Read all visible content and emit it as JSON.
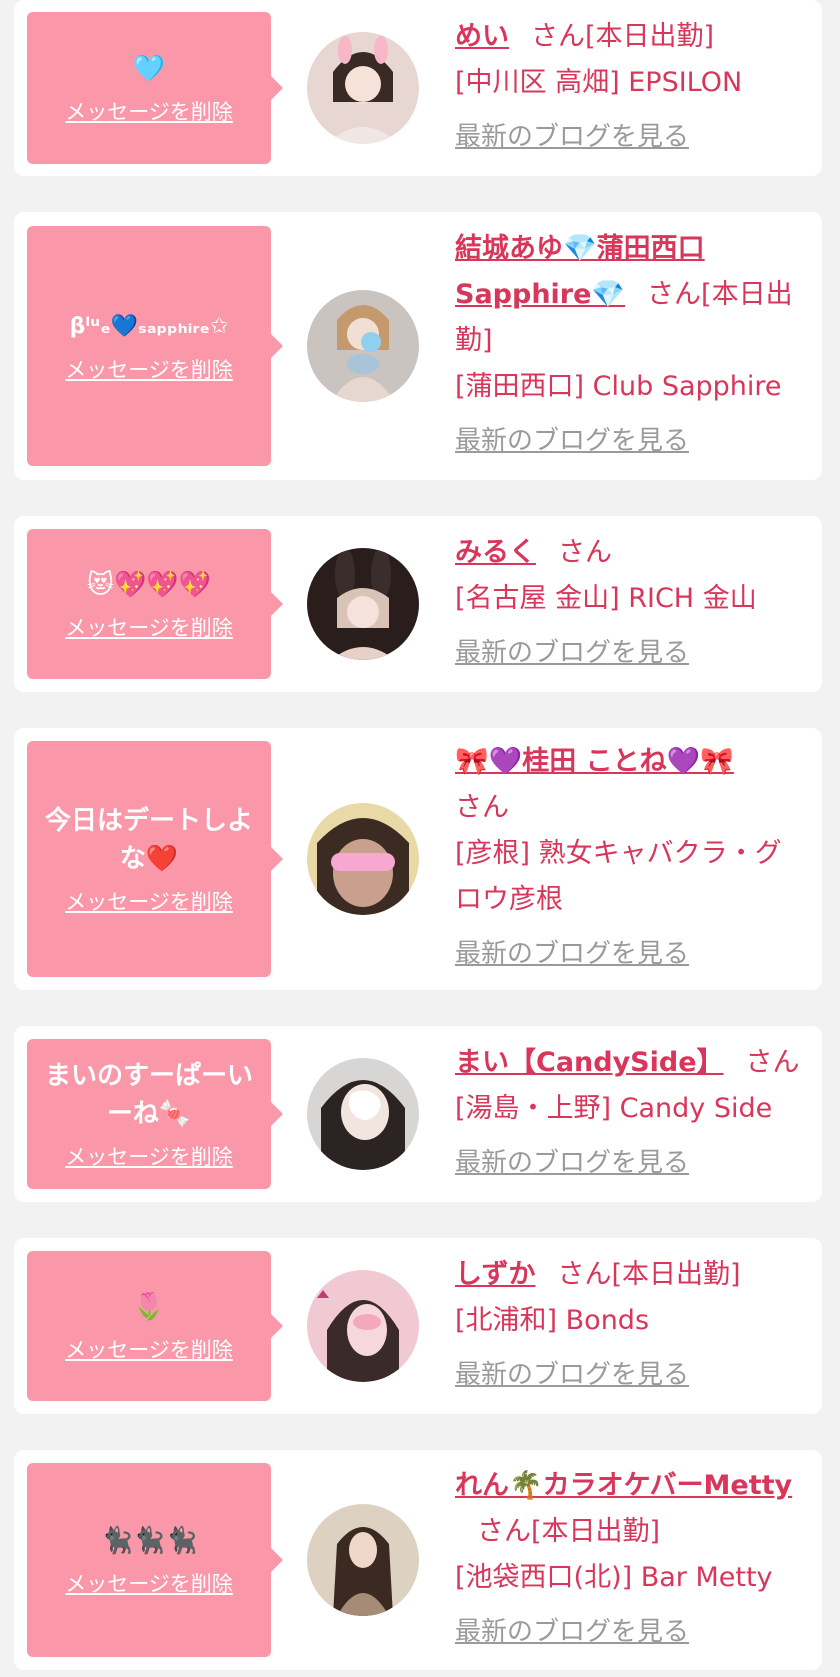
{
  "delete_label": "メッセージを削除",
  "blog_label": "最新のブログを見る",
  "san_label": "さん",
  "cards": [
    {
      "message": "🩵",
      "name": "めい",
      "status": "[本日出勤]",
      "shop": "[中川区 高畑] EPSILON"
    },
    {
      "message": "βˡᵘₑ💙ₛₐₚₚₕᵢᵣₑ✩",
      "name": "結城あゆ💎蒲田西口Sapphire💎",
      "status": "[本日出勤]",
      "shop": "[蒲田西口] Club Sapphire"
    },
    {
      "message": "😻💖💖💖",
      "name": "みるく",
      "status": "",
      "shop": "[名古屋 金山] RICH 金山"
    },
    {
      "message": "今日はデートしよな❤️",
      "name": "🎀💜桂田 ことね💜🎀",
      "status": "",
      "shop": "[彦根] 熟女キャバクラ・グロウ彦根"
    },
    {
      "message": "まいのすーぱーいーね🍬",
      "name": "まい【CandySide】",
      "status": "",
      "shop": "[湯島・上野] Candy Side"
    },
    {
      "message": "🌷",
      "name": "しずか",
      "status": "[本日出勤]",
      "shop": "[北浦和] Bonds"
    },
    {
      "message": "🐈‍⬛🐈‍⬛🐈‍⬛",
      "name": "れん🌴カラオケバーMetty",
      "status": "[本日出勤]",
      "shop": "[池袋西口(北)] Bar Metty"
    }
  ],
  "colors": {
    "accent": "#d8365a",
    "bubble": "#fa97a9",
    "muted": "#9a9a9a",
    "background": "#f2f2f2"
  }
}
